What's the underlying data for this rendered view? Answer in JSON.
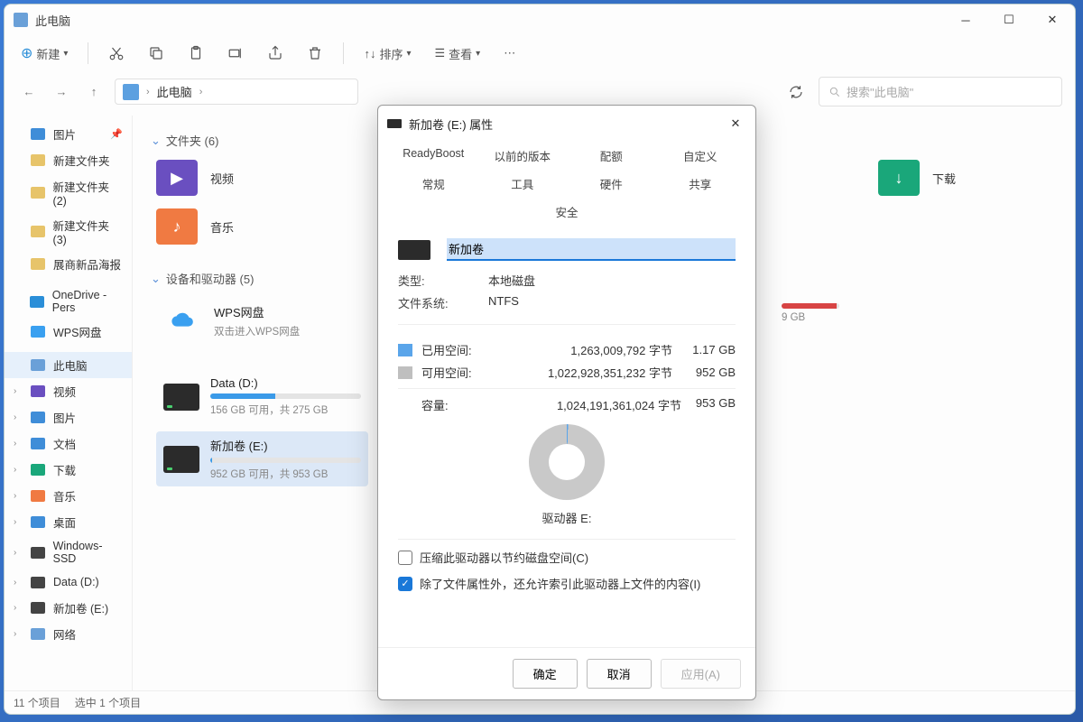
{
  "window": {
    "title": "此电脑",
    "search_placeholder": "搜索\"此电脑\""
  },
  "toolbar": {
    "new": "新建",
    "sort": "排序",
    "view": "查看"
  },
  "breadcrumb": {
    "root": "此电脑"
  },
  "sidebar": {
    "items": [
      {
        "label": "图片",
        "pinned": true,
        "ico": "#3f8dd8"
      },
      {
        "label": "新建文件夹",
        "ico": "#e7c46a"
      },
      {
        "label": "新建文件夹 (2)",
        "ico": "#e7c46a"
      },
      {
        "label": "新建文件夹 (3)",
        "ico": "#e7c46a"
      },
      {
        "label": "展商新品海报",
        "ico": "#e7c46a"
      },
      {
        "label": "OneDrive - Pers",
        "ico": "#2a8ed8"
      },
      {
        "label": "WPS网盘",
        "ico": "#3aa0f0"
      },
      {
        "label": "此电脑",
        "sel": true,
        "ico": "#6aa0d8"
      },
      {
        "label": "视频",
        "chev": true,
        "ico": "#6a4fc0"
      },
      {
        "label": "图片",
        "chev": true,
        "ico": "#3f8dd8"
      },
      {
        "label": "文档",
        "chev": true,
        "ico": "#3f8dd8"
      },
      {
        "label": "下载",
        "chev": true,
        "ico": "#1aa77a"
      },
      {
        "label": "音乐",
        "chev": true,
        "ico": "#f07a42"
      },
      {
        "label": "桌面",
        "chev": true,
        "ico": "#3f8dd8"
      },
      {
        "label": "Windows-SSD",
        "chev": true,
        "ico": "#444"
      },
      {
        "label": "Data (D:)",
        "chev": true,
        "ico": "#444"
      },
      {
        "label": "新加卷 (E:)",
        "chev": true,
        "ico": "#444"
      },
      {
        "label": "网络",
        "chev": true,
        "ico": "#6aa0d8"
      }
    ]
  },
  "groups": {
    "folders_hdr": "文件夹 (6)",
    "drives_hdr": "设备和驱动器 (5)"
  },
  "folders": {
    "video": "视频",
    "music": "音乐",
    "downloads": "下载"
  },
  "cloud": {
    "name": "WPS网盘",
    "sub": "双击进入WPS网盘"
  },
  "drive_e": {
    "name": "新加卷 (E:)",
    "sub": "952 GB 可用，共 953 GB"
  },
  "drive_unk": {
    "sub": "9 GB"
  },
  "drive_d": {
    "name": "Data (D:)",
    "sub": "156 GB 可用，共 275 GB"
  },
  "status": {
    "count": "11 个项目",
    "sel": "选中 1 个项目"
  },
  "dialog": {
    "title": "新加卷 (E:) 属性",
    "tabs_row1": [
      "ReadyBoost",
      "以前的版本",
      "配额",
      "自定义"
    ],
    "tabs_row2": [
      "常规",
      "工具",
      "硬件",
      "共享",
      "安全"
    ],
    "name_value": "新加卷",
    "type_k": "类型:",
    "type_v": "本地磁盘",
    "fs_k": "文件系统:",
    "fs_v": "NTFS",
    "used_label": "已用空间:",
    "used_bytes": "1,263,009,792 字节",
    "used_cap": "1.17 GB",
    "free_label": "可用空间:",
    "free_bytes": "1,022,928,351,232 字节",
    "free_cap": "952 GB",
    "cap_label": "容量:",
    "cap_bytes": "1,024,191,361,024 字节",
    "cap_cap": "953 GB",
    "pie_label": "驱动器 E:",
    "chk_compress": "压缩此驱动器以节约磁盘空间(C)",
    "chk_index": "除了文件属性外，还允许索引此驱动器上文件的内容(I)",
    "btn_ok": "确定",
    "btn_cancel": "取消",
    "btn_apply": "应用(A)"
  }
}
